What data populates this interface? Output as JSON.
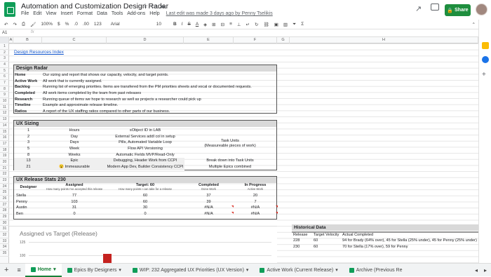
{
  "title": "Automation and Customization Design Radar",
  "menu": [
    "File",
    "Edit",
    "View",
    "Insert",
    "Format",
    "Data",
    "Tools",
    "Add-ons",
    "Help"
  ],
  "last_edit": "Last edit was made 3 days ago by Penny Tselikis",
  "share_label": "Share",
  "toolbar": {
    "zoom": "100%",
    "currency": "$",
    "percent": "%",
    "dec1": ".0",
    "dec2": ".00",
    "numfmt": "123",
    "font": "Arial",
    "size": "10",
    "bold": "B",
    "italic": "I",
    "strike": "S",
    "color": "A"
  },
  "formula": {
    "cell": "A1",
    "fx": "fx"
  },
  "columns": [
    "A",
    "B",
    "C",
    "D",
    "E",
    "F",
    "G",
    "H"
  ],
  "rows": [
    "1",
    "2",
    "3",
    "4",
    "5",
    "6",
    "7",
    "8",
    "9",
    "10",
    "11",
    "12",
    "13",
    "14",
    "15",
    "16",
    "17",
    "18",
    "19",
    "20",
    "21",
    "22",
    "23",
    "24",
    "25",
    "26",
    "27",
    "28",
    "29",
    "30",
    "31",
    "32",
    "33",
    "34",
    "35"
  ],
  "link": "Design Resources Index",
  "radar": {
    "header": "Design Radar",
    "items": [
      {
        "term": "Home",
        "desc": "Our sizing and report that shows our capacity, velocity, and target points."
      },
      {
        "term": "Active Work",
        "desc": "All work that is currently assigned."
      },
      {
        "term": "Backlog",
        "desc": "Running list of emerging priorities. Items are transfered from the PM priorities sheets and vocal or documented requests."
      },
      {
        "term": "Completed",
        "desc": "All work items completed by the team from past releases"
      },
      {
        "term": "Research",
        "desc": "Running queue of items we hope to research as well as projects a researcher could pick up"
      },
      {
        "term": "Timeline",
        "desc": "Example and approximate release timeline."
      },
      {
        "term": "Ratios",
        "desc": "A report of the UX staffing ratios compared to other parts of our business."
      }
    ]
  },
  "sizing": {
    "header": "UX Sizing",
    "rows": [
      {
        "pts": "1",
        "unit": "Hours",
        "ex": "sObject ID in LAB"
      },
      {
        "pts": "2",
        "unit": "Day",
        "ex": "External Services addl col in setup"
      },
      {
        "pts": "3",
        "unit": "Days",
        "ex": "Pills, Automated Variable Loop"
      },
      {
        "pts": "5",
        "unit": "Week",
        "ex": "Flow API Versioning"
      },
      {
        "pts": "8",
        "unit": "Weeks",
        "ex": "Automatic Fields  MVP/Read-Only"
      },
      {
        "pts": "13",
        "unit": "Epic",
        "ex": "Debugging, Header Work from CCPI"
      },
      {
        "pts": "21",
        "unit": "😮 Immeasurable",
        "ex": "Modern App Dev, Builder Consistency CCPI"
      }
    ],
    "task_units": "Task Units",
    "task_units_sub": "(Measureable pieces of work)",
    "break_down": "Break down into Task Units",
    "multiple_epics": "Multiple Epics combined"
  },
  "release": {
    "header": "UX Release Stats 230",
    "col_designer": "Designer",
    "col_assigned": "Assigned",
    "col_assigned_sub": "How many points I've accepted this release",
    "col_target": "Target: 60",
    "col_target_sub": "How many points I can take for a release",
    "col_completed": "Completed",
    "col_completed_sub": "Done Work",
    "col_progress": "In Progress",
    "col_progress_sub": "Active Work",
    "rows": [
      {
        "name": "Stella",
        "assigned": "77",
        "target": "60",
        "completed": "37",
        "progress": "20"
      },
      {
        "name": "Penny",
        "assigned": "103",
        "target": "60",
        "completed": "39",
        "progress": "7"
      },
      {
        "name": "Austin",
        "assigned": "31",
        "target": "30",
        "completed": "#N/A",
        "progress": "#N/A"
      },
      {
        "name": "Ben",
        "assigned": "0",
        "target": "0",
        "completed": "#N/A",
        "progress": "#N/A"
      }
    ]
  },
  "chart": {
    "title": "Assigned vs Target (Release)",
    "tick1": "125",
    "tick2": "100"
  },
  "chart_data": {
    "type": "bar",
    "title": "Assigned vs Target (Release)",
    "yticks": [
      125,
      100
    ],
    "visible_bar_value": 103,
    "visible_bar_color": "#c5221f"
  },
  "historical": {
    "header": "Historical Data",
    "cols": [
      "Release",
      "Target Velocity",
      "Actual Completed"
    ],
    "rows": [
      {
        "release": "228",
        "target": "60",
        "actual": "94 for Brady (64% over), 45 for Stella (25% under), 45 for Penny (25% under)"
      },
      {
        "release": "230",
        "target": "60",
        "actual": "70 for Stella (17% over), 59 for Penny"
      }
    ]
  },
  "tabs": [
    "Home",
    "Epics By Designers",
    "WIP: 232 Aggregated UX Priorities (UX Version)",
    "Active Work (Current Release)",
    "Archive (Previous Re"
  ],
  "colors": {
    "accent": "#1e8e3e",
    "section_bg": "#d9d9d9",
    "bar": "#c5221f",
    "link": "#1155cc"
  }
}
